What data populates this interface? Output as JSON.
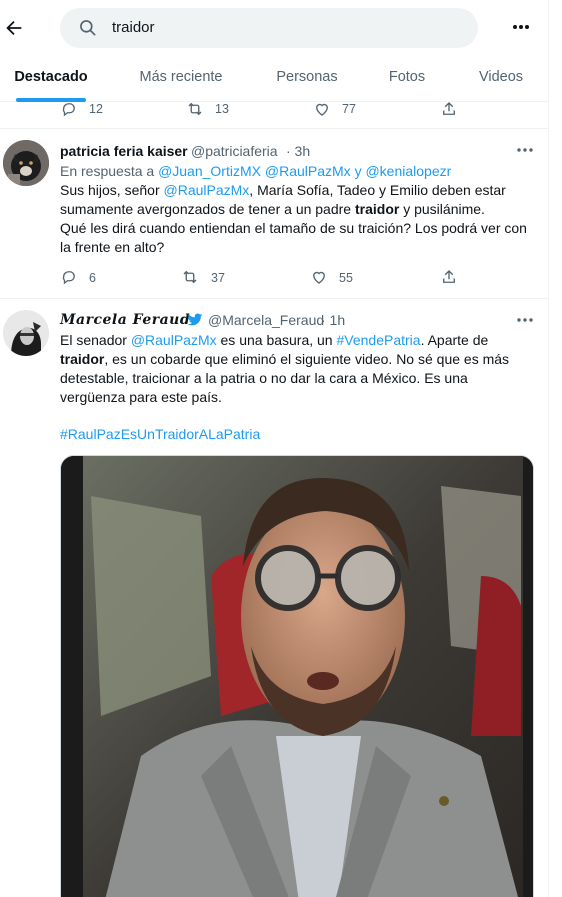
{
  "search": {
    "query": "traidor"
  },
  "icons": {
    "back": "arrow-left-icon",
    "search": "search-icon",
    "more": "more-horizontal-icon",
    "reply": "reply-icon",
    "retweet": "retweet-icon",
    "like": "heart-icon",
    "share": "share-icon",
    "verified": "bird-icon"
  },
  "tabs": [
    "Destacado",
    "Más reciente",
    "Personas",
    "Fotos",
    "Videos"
  ],
  "prev_tweet": {
    "replies": "12",
    "retweets": "13",
    "likes": "77"
  },
  "tweet1": {
    "name": "patricia feria kaiser",
    "handle": "@patriciaferia",
    "time": "· 3h",
    "reply_prefix": "En respuesta a",
    "reply_to_1": "@Juan_OrtizMX",
    "reply_to_2": "@RaulPazMx",
    "reply_and": "y",
    "reply_to_3": "@kenialopezr",
    "l1_a": "Sus hijos, señor",
    "l1_mention": "@RaulPazMx",
    "l1_b": ", María Sofía, Tadeo y Emilio deben estar",
    "l2_a": "sumamente avergonzados de tener a un padre",
    "l2_bold": "traidor",
    "l2_b": "y pusilánime.",
    "l3": "Qué les dirá cuando entiendan el tamaño de su traición? Los podrá ver con",
    "l4": "la frente en alto?",
    "replies": "6",
    "retweets": "37",
    "likes": "55"
  },
  "tweet2": {
    "name": "Marcela Feraud",
    "handle": "@Marcela_Feraud",
    "time": "· 1h",
    "l1_a": "El senador",
    "l1_mention": "@RaulPazMx",
    "l1_b": "es una basura, un",
    "l1_tag": "#VendePatria",
    "l1_c": ". Aparte de",
    "l2_bold": "traidor",
    "l2_b": ", es un cobarde que eliminó el siguiente video. No sé que es más",
    "l3": "detestable, traicionar a la patria o no dar la cara a México. Es una",
    "l4": "vergüenza para este país.",
    "hashtag": "#RaulPazEsUnTraidorALaPatria"
  },
  "colors": {
    "accent": "#1d9bf0",
    "text": "#0f1419",
    "muted": "#536471",
    "search_bg": "#eff3f4"
  }
}
